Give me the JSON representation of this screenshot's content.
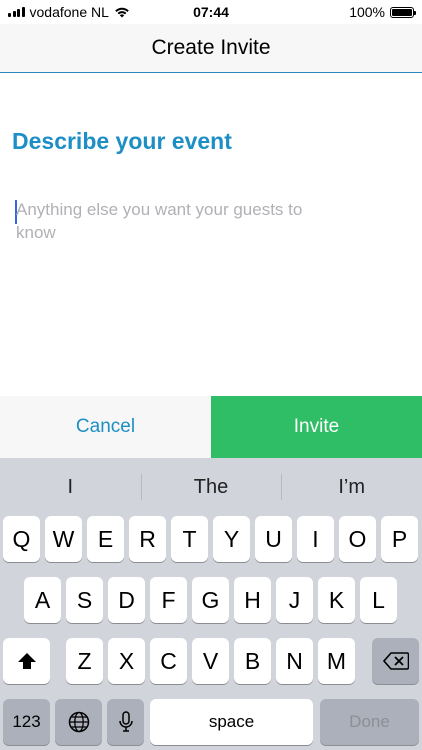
{
  "status_bar": {
    "carrier": "vodafone NL",
    "time": "07:44",
    "battery": "100%"
  },
  "navbar": {
    "title": "Create Invite"
  },
  "form": {
    "heading": "Describe your event",
    "placeholder": "Anything else you want your guests to know"
  },
  "actions": {
    "cancel_label": "Cancel",
    "invite_label": "Invite"
  },
  "keyboard": {
    "suggestions": [
      "I",
      "The",
      "I’m"
    ],
    "row1": [
      "Q",
      "W",
      "E",
      "R",
      "T",
      "Y",
      "U",
      "I",
      "O",
      "P"
    ],
    "row2": [
      "A",
      "S",
      "D",
      "F",
      "G",
      "H",
      "J",
      "K",
      "L"
    ],
    "row3": [
      "Z",
      "X",
      "C",
      "V",
      "B",
      "N",
      "M"
    ],
    "numbers_label": "123",
    "space_label": "space",
    "done_label": "Done"
  },
  "colors": {
    "accent": "#1d8fc4",
    "invite": "#2fbd66",
    "keyboard_bg": "#d1d4db"
  }
}
